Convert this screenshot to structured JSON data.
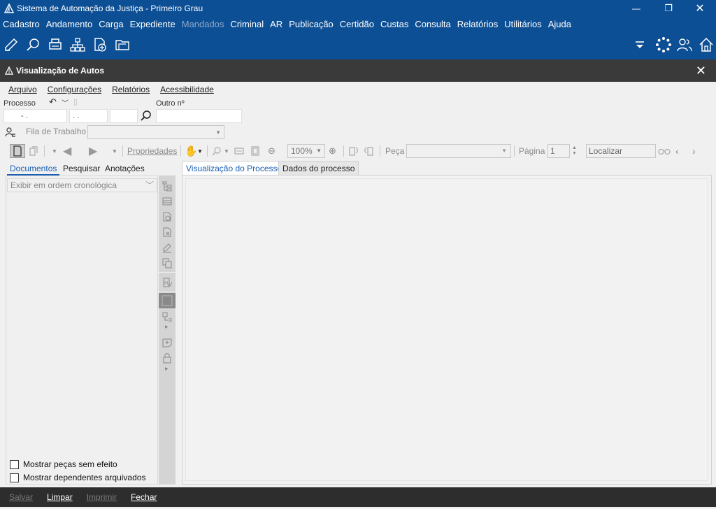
{
  "app": {
    "title": "Sistema de Automação da Justiça - Primeiro Grau"
  },
  "window_controls": {
    "minimize": "—",
    "restore": "❐",
    "close": "✕"
  },
  "main_menu": [
    {
      "label": "Cadastro",
      "enabled": true
    },
    {
      "label": "Andamento",
      "enabled": true
    },
    {
      "label": "Carga",
      "enabled": true
    },
    {
      "label": "Expediente",
      "enabled": true
    },
    {
      "label": "Mandados",
      "enabled": false
    },
    {
      "label": "Criminal",
      "enabled": true
    },
    {
      "label": "AR",
      "enabled": true
    },
    {
      "label": "Publicação",
      "enabled": true
    },
    {
      "label": "Certidão",
      "enabled": true
    },
    {
      "label": "Custas",
      "enabled": true
    },
    {
      "label": "Consulta",
      "enabled": true
    },
    {
      "label": "Relatórios",
      "enabled": true
    },
    {
      "label": "Utilitários",
      "enabled": true
    },
    {
      "label": "Ajuda",
      "enabled": true
    }
  ],
  "inner_window": {
    "title": "Visualização de Autos",
    "close": "✕"
  },
  "inner_menu": [
    "Arquivo",
    "Configurações",
    "Relatórios",
    "Acessibilidade"
  ],
  "form": {
    "processo_label": "Processo",
    "processo_part1": "- .",
    "processo_part2": ". .",
    "processo_part3": "",
    "outro_label": "Outro nº",
    "outro_value": "",
    "fila_label": "Fila de Trabalho",
    "fila_value": ""
  },
  "doc_toolbar": {
    "propriedades": "Propriedades",
    "zoom": "100%",
    "peca_label": "Peça",
    "pagina_label": "Página",
    "pagina_value": "1",
    "localizar_placeholder": "Localizar"
  },
  "left_tabs": [
    "Documentos",
    "Pesquisar",
    "Anotações"
  ],
  "order_select": "Exibir em ordem cronológica",
  "checkboxes": [
    {
      "label": "Mostrar peças sem efeito",
      "checked": false
    },
    {
      "label": "Mostrar dependentes arquivados",
      "checked": false
    }
  ],
  "right_tabs": [
    "Visualização do Processo",
    "Dados do processo"
  ],
  "bottom_buttons": [
    {
      "label": "Salvar",
      "enabled": false
    },
    {
      "label": "Limpar",
      "enabled": true
    },
    {
      "label": "Imprimir",
      "enabled": false
    },
    {
      "label": "Fechar",
      "enabled": true
    }
  ],
  "colors": {
    "title_bar": "#0d4f94",
    "inner_title": "#3a3a3a",
    "bottom_bar": "#2d2d2d",
    "active_tab": "#1a5fb4"
  }
}
